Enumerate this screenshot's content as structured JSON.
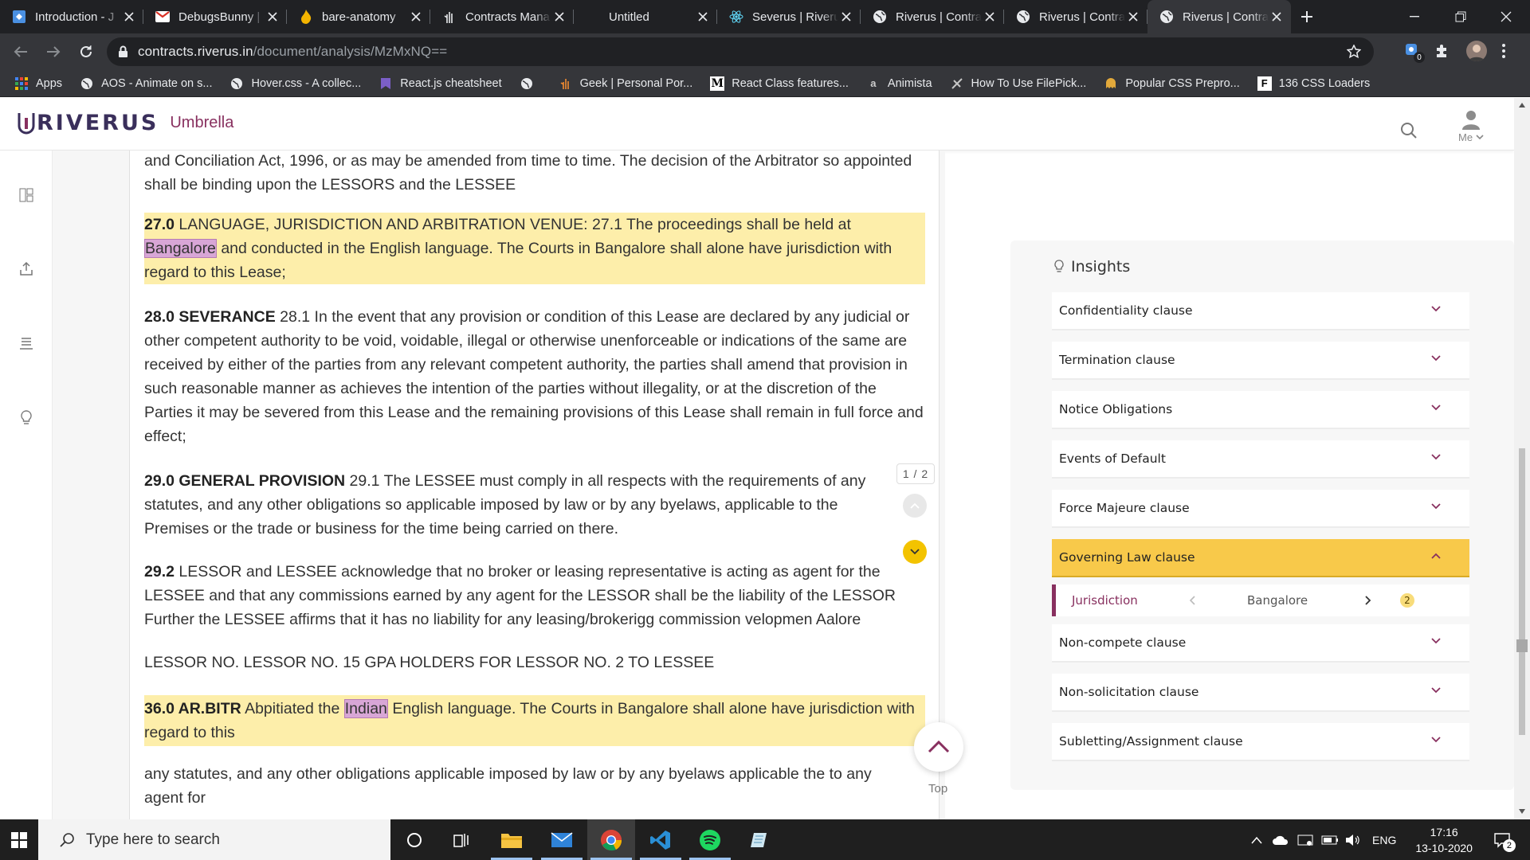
{
  "browser": {
    "tabs": [
      {
        "title": "Introduction - J",
        "icon": "codepen-style-icon"
      },
      {
        "title": "DebugsBunny | C",
        "icon": "gmail-icon"
      },
      {
        "title": "bare-anatomy",
        "icon": "flame-icon"
      },
      {
        "title": "Contracts Mana",
        "icon": "hand-icon"
      },
      {
        "title": "Untitled",
        "icon": "blank-icon"
      },
      {
        "title": "Severus | Riveru",
        "icon": "react-icon"
      },
      {
        "title": "Riverus | Contra",
        "icon": "globe-icon"
      },
      {
        "title": "Riverus | Contra",
        "icon": "globe-icon"
      },
      {
        "title": "Riverus | Contra",
        "icon": "globe-icon"
      }
    ],
    "active_tab": 8,
    "url_host": "contracts.riverus.in",
    "url_path": "/document/analysis/MzMxNQ==",
    "extension_badge": "0",
    "bookmarks": [
      {
        "label": "Apps",
        "icon": "apps-grid-icon"
      },
      {
        "label": "AOS - Animate on s...",
        "icon": "globe-icon"
      },
      {
        "label": "Hover.css - A collec...",
        "icon": "globe-icon"
      },
      {
        "label": "React.js cheatsheet",
        "icon": "devhints-icon"
      },
      {
        "label": "",
        "icon": "globe-icon"
      },
      {
        "label": "Geek | Personal Por...",
        "icon": "hand-icon"
      },
      {
        "label": "React Class features...",
        "icon": "medium-icon"
      },
      {
        "label": "Animista",
        "icon": "animista-icon"
      },
      {
        "label": "How To Use FilePick...",
        "icon": "filepicker-icon"
      },
      {
        "label": "Popular CSS Prepro...",
        "icon": "ghost-icon"
      },
      {
        "label": "136 CSS Loaders",
        "icon": "f-box-icon"
      }
    ]
  },
  "app": {
    "brand": "RIVERUS",
    "product": "Umbrella",
    "user_label": "Me"
  },
  "document": {
    "p0": "and Conciliation Act, 1996, or as may be amended from time to time. The decision of the Arbitrator so appointed shall be binding upon the LESSORS and the LESSEE",
    "p1_head": "27.0",
    "p1_a": " LANGUAGE, JURISDICTION AND ARBITRATION VENUE: 27.1 The proceedings shall be held at ",
    "p1_mark": "Bangalore",
    "p1_b": " and conducted in the English language. The Courts in Bangalore shall alone have jurisdiction with regard to this Lease;",
    "p2_head": "28.0 SEVERANCE",
    "p2_body": " 28.1 In the event that any provision or condition of this Lease are declared by any judicial or other competent authority to be void, voidable, illegal or otherwise unenforceable or indications of the same are received by either of the parties from any relevant competent authority, the parties shall amend that provision in such reasonable manner as achieves the intention of the parties without illegality, or at the discretion of the Parties it may be severed from this Lease and the remaining provisions of this Lease shall remain in full force and effect;",
    "p3_head": "29.0 GENERAL PROVISION",
    "p3_body": " 29.1 The LESSEE must comply in all respects with the requirements of any statutes, and any other obligations so applicable imposed by law or by any byelaws, applicable to the Premises or the trade or business for the time being carried on there.",
    "p4_head": "29.2",
    "p4_body": " LESSOR and LESSEE acknowledge that no broker or leasing representative is acting as agent for the LESSEE and that any commissions earned by any agent for the LESSOR shall be the liability of the LESSOR Further the LESSEE affirms that it has no liability for any leasing/brokerigg commission velopmen Aalore",
    "p5": "LESSOR NO. LESSOR NO. 15 GPA HOLDERS FOR LESSOR NO. 2 TO LESSEE",
    "p6_head": "36.0 AR.BITR",
    "p6_a": " Abpitiated the ",
    "p6_mark": "Indian",
    "p6_b": " English language. The Courts in Bangalore shall alone have jurisdiction with regard to this",
    "p7": "any statutes, and any other obligations applicable imposed by law or by any byelaws applicable the to any agent for",
    "page_indicator": "1 / 2",
    "top_label": "Top"
  },
  "insights": {
    "title": "Insights",
    "clauses": [
      "Confidentiality clause",
      "Termination clause",
      "Notice Obligations",
      "Events of Default",
      "Force Majeure clause",
      "Governing Law clause",
      "Non-compete clause",
      "Non-solicitation clause",
      "Subletting/Assignment clause"
    ],
    "open_clause": "Governing Law clause",
    "sub": {
      "label": "Jurisdiction",
      "value": "Bangalore",
      "count": "2"
    }
  },
  "taskbar": {
    "search_placeholder": "Type here to search",
    "language": "ENG",
    "time": "17:16",
    "date": "13-10-2020",
    "notification_count": "2"
  },
  "colors": {
    "brand": "#88305f",
    "highlight": "#fdeeaa",
    "accent": "#f8c94a",
    "chrome": "#202124"
  }
}
